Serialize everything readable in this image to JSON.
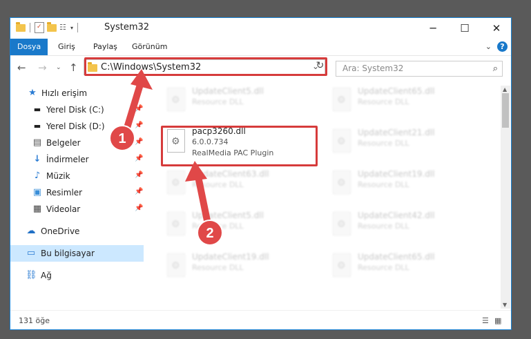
{
  "window": {
    "title": "System32"
  },
  "ribbon": {
    "tabs": [
      "Dosya",
      "Giriş",
      "Paylaş",
      "Görünüm"
    ],
    "help": "?"
  },
  "address": {
    "path": "C:\\Windows\\System32"
  },
  "search": {
    "placeholder": "Ara: System32"
  },
  "sidebar": {
    "items": [
      {
        "label": "Hızlı erişim"
      },
      {
        "label": "Yerel Disk (C:)"
      },
      {
        "label": "Yerel Disk (D:)"
      },
      {
        "label": "Belgeler"
      },
      {
        "label": "İndirmeler"
      },
      {
        "label": "Müzik"
      },
      {
        "label": "Resimler"
      },
      {
        "label": "Videolar"
      },
      {
        "label": "OneDrive"
      },
      {
        "label": "Bu bilgisayar"
      },
      {
        "label": "Ağ"
      }
    ]
  },
  "files": [
    {
      "name": "UpdateClient5.dll",
      "desc": "Resource DLL"
    },
    {
      "name": "UpdateClient65.dll",
      "desc": "Resource DLL"
    },
    {
      "name": "pacp3260.dll",
      "version": "6.0.0.734",
      "desc": "RealMedia PAC Plugin"
    },
    {
      "name": "UpdateClient21.dll",
      "desc": "Resource DLL"
    },
    {
      "name": "UpdateClient63.dll",
      "desc": "Resource DLL"
    },
    {
      "name": "UpdateClient19.dll",
      "desc": "Resource DLL"
    },
    {
      "name": "UpdateClient5.dll",
      "desc": "Resource DLL"
    },
    {
      "name": "UpdateClient42.dll",
      "desc": "Resource DLL"
    },
    {
      "name": "UpdateClient19.dll",
      "desc": "Resource DLL"
    },
    {
      "name": "UpdateClient65.dll",
      "desc": "Resource DLL"
    }
  ],
  "status": {
    "count": "131 öğe"
  },
  "annotations": {
    "step1": "1",
    "step2": "2"
  },
  "colors": {
    "accent": "#1979ca",
    "highlight": "#d63b3b"
  }
}
